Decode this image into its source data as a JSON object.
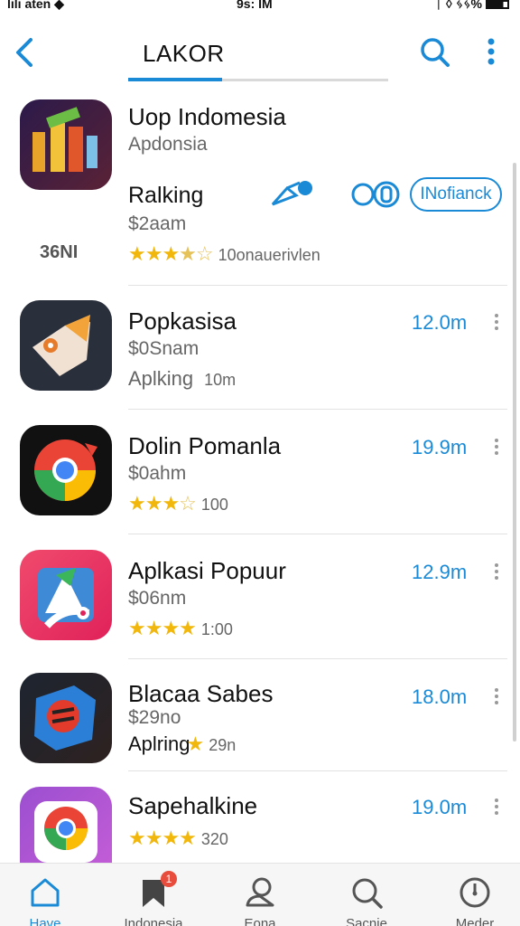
{
  "status_bar": {
    "carrier": "lılı aten ◆",
    "time": "9s: IM",
    "battery": "ᛁ ◊ ᛃᛃ%"
  },
  "header": {
    "tab_label": "LAKOR"
  },
  "apps": [
    {
      "name": "Uop Indomesia",
      "subtitle": "Apdonsia",
      "rank_label": "Ralking",
      "price": "$2aam",
      "side_label": "36NI",
      "rating_text": "10onauerivlen",
      "action_label": "INofianck",
      "stars": 3.5
    },
    {
      "name": "Popkasisa",
      "subtitle": "$0Snam",
      "line3": "Aplking",
      "line3_meta": "10m",
      "size": "12.0m"
    },
    {
      "name": "Dolin Pomanla",
      "subtitle": "$0ahm",
      "rating_text": "100",
      "size": "19.9m",
      "stars": 3.5
    },
    {
      "name": "Aplkasi Popuur",
      "subtitle": "$06nm",
      "rating_text": "1:00",
      "size": "12.9m",
      "stars": 4
    },
    {
      "name": "Blacaa Sabes",
      "subtitle": "$29no",
      "line3": "Aplring",
      "line3_meta": "29n",
      "size": "18.0m"
    },
    {
      "name": "Sapehalkine",
      "rating_text": "320",
      "size": "19.0m",
      "stars": 4
    }
  ],
  "bottom_nav": [
    {
      "label": "Have",
      "icon": "home-icon",
      "active": true
    },
    {
      "label": "Indonesia",
      "icon": "bookmark-icon",
      "badge": "1"
    },
    {
      "label": "Eona",
      "icon": "person-icon"
    },
    {
      "label": "Sacnie",
      "icon": "search-icon"
    },
    {
      "label": "Meder",
      "icon": "clock-icon"
    }
  ],
  "colors": {
    "accent": "#1a8ad6",
    "star": "#f2b70c",
    "badge": "#e74c3c"
  }
}
